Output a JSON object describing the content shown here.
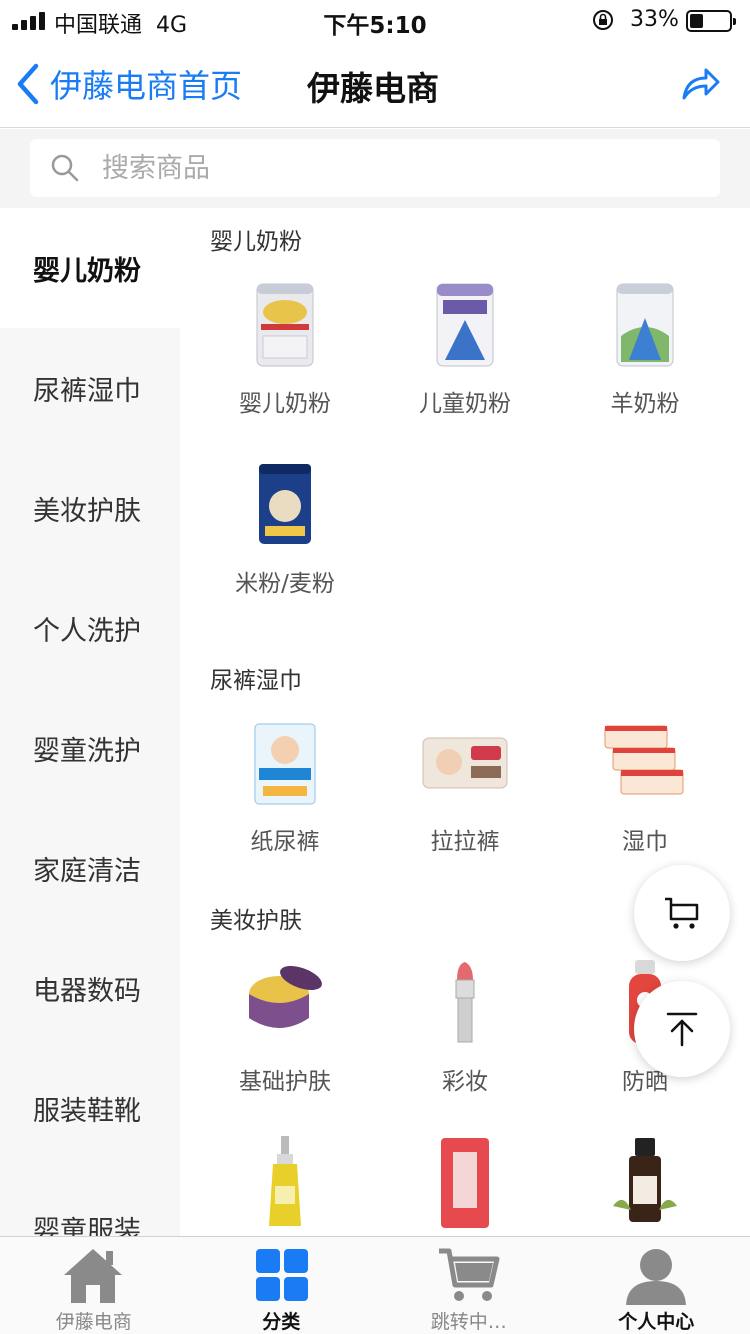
{
  "status_bar": {
    "carrier": "中国联通",
    "network": "4G",
    "time": "下午5:10",
    "battery": "33%",
    "battery_level": 0.33
  },
  "nav": {
    "back_label": "伊藤电商首页",
    "title": "伊藤电商",
    "back_icon": "chevron-left-icon",
    "share_icon": "share-icon"
  },
  "search": {
    "placeholder": "搜索商品",
    "value": ""
  },
  "sidebar": {
    "items": [
      {
        "label": "婴儿奶粉",
        "active": true
      },
      {
        "label": "尿裤湿巾",
        "active": false
      },
      {
        "label": "美妆护肤",
        "active": false
      },
      {
        "label": "个人洗护",
        "active": false
      },
      {
        "label": "婴童洗护",
        "active": false
      },
      {
        "label": "家庭清洁",
        "active": false
      },
      {
        "label": "电器数码",
        "active": false
      },
      {
        "label": "服装鞋靴",
        "active": false
      },
      {
        "label": "婴童服装",
        "active": false
      }
    ]
  },
  "sections": [
    {
      "title": "婴儿奶粉",
      "products": [
        {
          "label": "婴儿奶粉",
          "icon": "milk-powder-can-icon"
        },
        {
          "label": "儿童奶粉",
          "icon": "milk-powder-can-icon"
        },
        {
          "label": "羊奶粉",
          "icon": "milk-powder-can-icon"
        },
        {
          "label": "米粉/麦粉",
          "icon": "rice-cereal-jar-icon"
        }
      ]
    },
    {
      "title": "尿裤湿巾",
      "products": [
        {
          "label": "纸尿裤",
          "icon": "diaper-pack-icon"
        },
        {
          "label": "拉拉裤",
          "icon": "pull-up-pants-icon"
        },
        {
          "label": "湿巾",
          "icon": "wet-wipes-icon"
        }
      ]
    },
    {
      "title": "美妆护肤",
      "products": [
        {
          "label": "基础护肤",
          "icon": "cream-jar-icon"
        },
        {
          "label": "彩妆",
          "icon": "lipstick-icon"
        },
        {
          "label": "防晒",
          "icon": "sunscreen-spray-icon"
        },
        {
          "label": "",
          "icon": "cleansing-oil-bottle-icon"
        },
        {
          "label": "",
          "icon": "face-mask-pack-icon"
        },
        {
          "label": "",
          "icon": "essential-oil-bottle-icon"
        }
      ]
    }
  ],
  "floating": {
    "cart_icon": "cart-icon",
    "top_icon": "back-to-top-icon"
  },
  "tab_bar": {
    "tabs": [
      {
        "label": "伊藤电商",
        "icon": "home-icon",
        "active": false
      },
      {
        "label": "分类",
        "icon": "category-grid-icon",
        "active": true
      },
      {
        "label": "跳转中…",
        "icon": "shopping-cart-icon",
        "active": false
      },
      {
        "label": "个人中心",
        "icon": "user-icon",
        "active": false
      }
    ]
  },
  "colors": {
    "accent": "#1a7cf5",
    "sidebar_bg": "#f7f7f7",
    "search_bg": "#f4f4f4"
  }
}
